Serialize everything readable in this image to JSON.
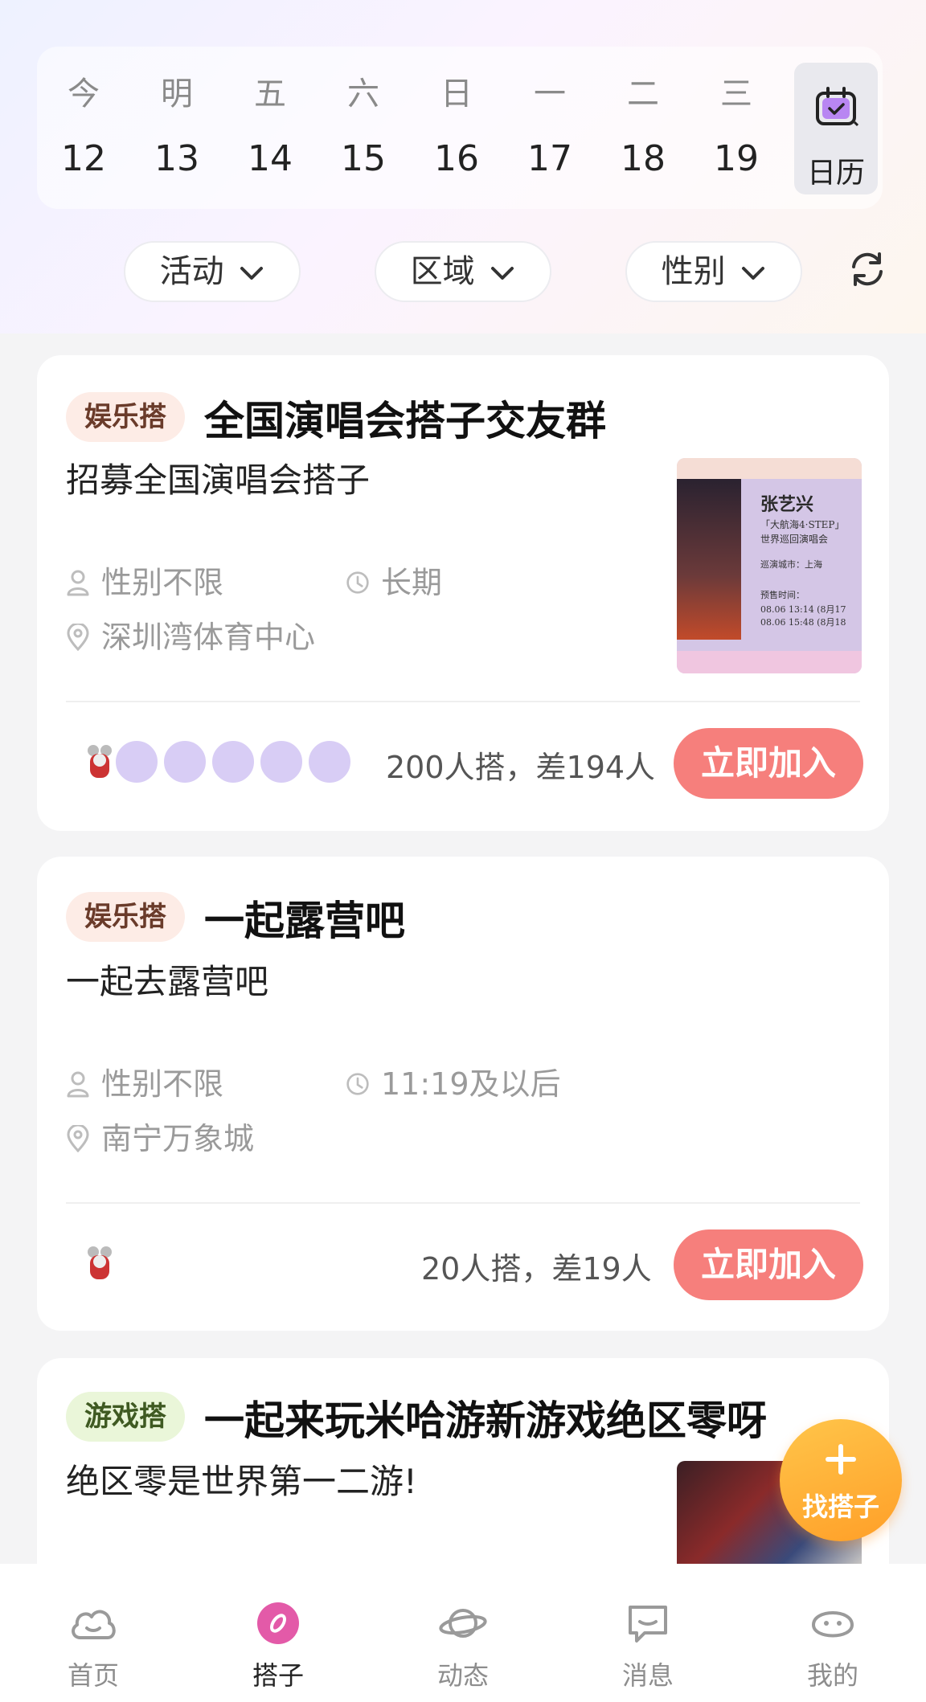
{
  "date_bar": {
    "days": [
      {
        "weekday": "今",
        "date": "12"
      },
      {
        "weekday": "明",
        "date": "13"
      },
      {
        "weekday": "五",
        "date": "14"
      },
      {
        "weekday": "六",
        "date": "15"
      },
      {
        "weekday": "日",
        "date": "16"
      },
      {
        "weekday": "一",
        "date": "17"
      },
      {
        "weekday": "二",
        "date": "18"
      },
      {
        "weekday": "三",
        "date": "19"
      }
    ],
    "calendar_label": "日历",
    "calendar_icon": "calendar-check-icon"
  },
  "filters": {
    "activity": "活动",
    "region": "区域",
    "gender": "性别",
    "refresh_icon": "refresh-icon"
  },
  "cards": [
    {
      "tag": "娱乐搭",
      "title": "全国演唱会搭子交友群",
      "description": "招募全国演唱会搭子",
      "gender": "性别不限",
      "time": "长期",
      "location": "深圳湾体育中心",
      "count_text": "200人搭，差194人",
      "join_label": "立即加入",
      "thumbnail": {
        "name": "张艺兴",
        "line1": "「大航海4·STEP」",
        "line2": "世界巡回演唱会",
        "line3": "巡演城市：上海",
        "line4": "预售时间：",
        "line5": "08.06 13:14 (8月17",
        "line6": "08.06 15:48 (8月18"
      }
    },
    {
      "tag": "娱乐搭",
      "title": "一起露营吧",
      "description": "一起去露营吧",
      "gender": "性别不限",
      "time": "11:19及以后",
      "location": "南宁万象城",
      "count_text": "20人搭，差19人",
      "join_label": "立即加入"
    },
    {
      "tag": "游戏搭",
      "title": "一起来玩米哈游新游戏绝区零呀",
      "description": "绝区零是世界第一二游!"
    }
  ],
  "fab": {
    "label": "找搭子",
    "icon": "plus-icon"
  },
  "bottom_nav": [
    {
      "label": "首页",
      "icon": "home-cloud-icon"
    },
    {
      "label": "搭子",
      "icon": "partner-icon"
    },
    {
      "label": "动态",
      "icon": "planet-icon"
    },
    {
      "label": "消息",
      "icon": "message-icon"
    },
    {
      "label": "我的",
      "icon": "profile-icon"
    }
  ],
  "colors": {
    "accent": "#f67f7c",
    "fab": "#ffb03a",
    "active_nav": "#e35aa8"
  }
}
